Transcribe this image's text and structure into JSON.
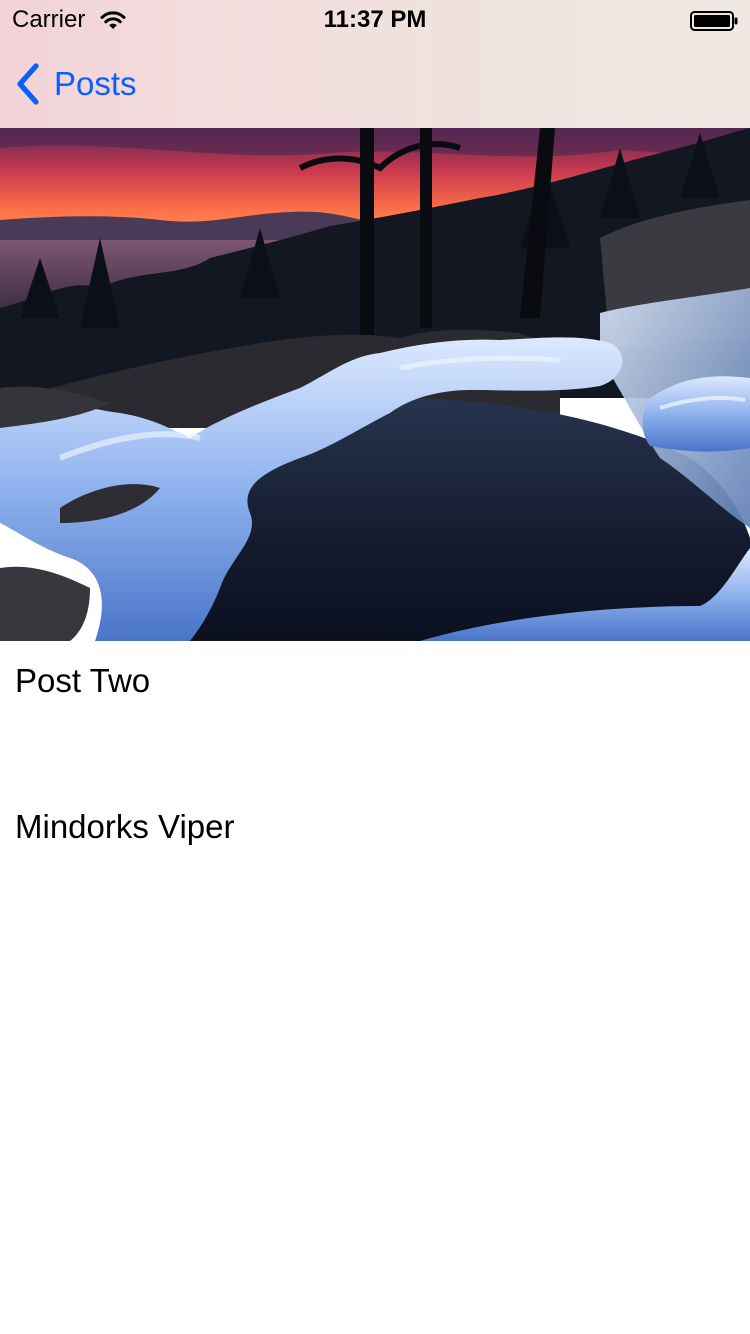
{
  "status_bar": {
    "carrier": "Carrier",
    "time": "11:37 PM",
    "wifi_icon": "wifi-icon",
    "battery_icon": "battery-icon"
  },
  "nav": {
    "back_label": "Posts",
    "back_icon": "chevron-left-icon",
    "accent_color": "#0a60fe"
  },
  "post": {
    "image": "sunset-waterfall-photo",
    "title": "Post Two",
    "author": "Mindorks Viper"
  }
}
